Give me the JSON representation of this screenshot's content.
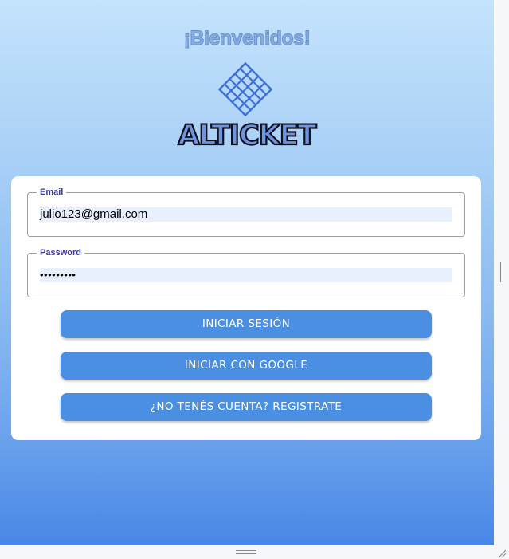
{
  "header": {
    "welcome": "¡Bienvenidos!",
    "brand": "ALTICKET",
    "logo_icon": "ticket-grid-logo-icon"
  },
  "form": {
    "email": {
      "label": "Email",
      "value": "julio123@gmail.com"
    },
    "password": {
      "label": "Password",
      "value": "•••••••••"
    }
  },
  "buttons": {
    "login": "INICIAR SESIÓN",
    "google": "INICIAR CON GOOGLE",
    "register": "¿NO TENÉS CUENTA? REGISTRATE"
  },
  "colors": {
    "accent": "#4a8fe2",
    "gradient_top": "#c4e3fc",
    "gradient_bottom": "#4887e6",
    "legend": "#3a3aa6",
    "autofill": "#e8f0fe"
  }
}
